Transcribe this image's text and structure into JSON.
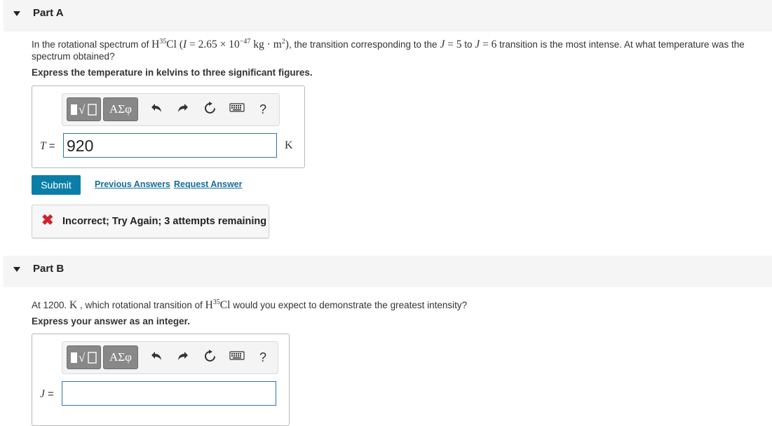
{
  "partA": {
    "title": "Part A",
    "question_prefix": "In the rotational spectrum of ",
    "molecule_H": "H",
    "molecule_iso": "35",
    "molecule_Cl": "Cl",
    "inertia_open": " (",
    "inertia_var": "I",
    "inertia_eq": " = 2.65 × 10",
    "inertia_exp": "−47",
    "inertia_unit": " kg · m",
    "inertia_unit_exp": "2",
    "inertia_close": ")",
    "question_mid": ", the transition corresponding to the ",
    "J_var1": "J",
    "J_eq1": " = 5",
    "question_to": " to ",
    "J_var2": "J",
    "J_eq2": " = 6",
    "question_suffix": " transition is the most intense. At what temperature was the",
    "question_line2": "spectrum obtained?",
    "instruction": "Express the temperature in kelvins to three significant figures.",
    "answer_label": "T",
    "answer_eq": " =",
    "answer_value": "920",
    "unit": "K",
    "submit_label": "Submit",
    "previous_answers_label": "Previous Answers",
    "request_answer_label": "Request Answer",
    "feedback_icon": "✖",
    "feedback_text": "Incorrect; Try Again; 3 attempts remaining"
  },
  "partB": {
    "title": "Part B",
    "question_prefix": "At 1200. ",
    "temp_unit": "K",
    "question_mid": " , which rotational transition of ",
    "molecule_H": "H",
    "molecule_iso": "35",
    "molecule_Cl": "Cl",
    "question_suffix": " would you expect to demonstrate the greatest intensity?",
    "instruction": "Express your answer as an integer.",
    "answer_label": "J",
    "answer_eq": " =",
    "answer_value": ""
  },
  "toolbar": {
    "templates_icon": "templates-icon",
    "symbols_label": "ΑΣφ",
    "undo_icon": "undo-icon",
    "redo_icon": "redo-icon",
    "reset_icon": "reset-icon",
    "keyboard_icon": "keyboard-icon",
    "help_label": "?"
  },
  "colors": {
    "accent": "#0b7ea8",
    "link": "#136e9a",
    "input_border": "#2a75b0",
    "error": "#d0222b",
    "header_bg": "#f5f5f5"
  }
}
